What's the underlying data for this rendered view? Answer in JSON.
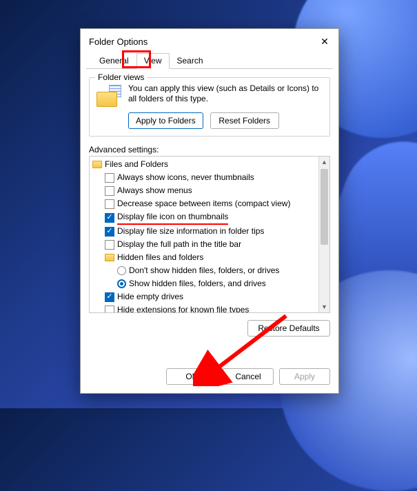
{
  "dialog": {
    "title": "Folder Options",
    "close_glyph": "✕"
  },
  "tabs": {
    "general": "General",
    "view": "View",
    "search": "Search"
  },
  "folder_views": {
    "group_title": "Folder views",
    "description": "You can apply this view (such as Details or Icons) to all folders of this type.",
    "apply_btn": "Apply to Folders",
    "reset_btn": "Reset Folders"
  },
  "advanced": {
    "label": "Advanced settings:",
    "root": "Files and Folders",
    "items": [
      {
        "label": "Always show icons, never thumbnails",
        "checked": false
      },
      {
        "label": "Always show menus",
        "checked": false
      },
      {
        "label": "Decrease space between items (compact view)",
        "checked": false
      },
      {
        "label": "Display file icon on thumbnails",
        "checked": true
      },
      {
        "label": "Display file size information in folder tips",
        "checked": true
      },
      {
        "label": "Display the full path in the title bar",
        "checked": false
      }
    ],
    "hidden_group": {
      "label": "Hidden files and folders",
      "options": [
        {
          "label": "Don't show hidden files, folders, or drives",
          "selected": false
        },
        {
          "label": "Show hidden files, folders, and drives",
          "selected": true
        }
      ]
    },
    "tail": [
      {
        "label": "Hide empty drives",
        "checked": true
      },
      {
        "label": "Hide extensions for known file types",
        "checked": false
      }
    ],
    "restore_btn": "Restore Defaults"
  },
  "footer": {
    "ok": "OK",
    "cancel": "Cancel",
    "apply": "Apply"
  }
}
